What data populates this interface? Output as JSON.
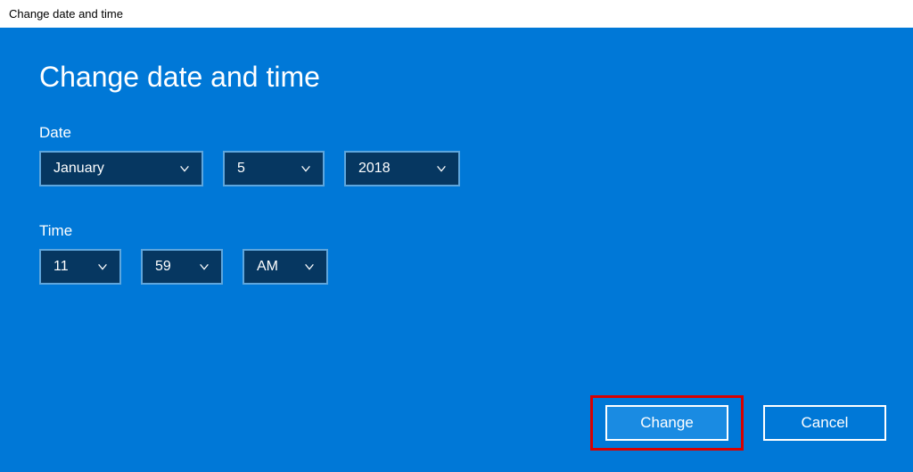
{
  "window": {
    "title": "Change date and time"
  },
  "heading": "Change date and time",
  "date": {
    "label": "Date",
    "month": "January",
    "day": "5",
    "year": "2018"
  },
  "time": {
    "label": "Time",
    "hour": "11",
    "minute": "59",
    "ampm": "AM"
  },
  "buttons": {
    "change": "Change",
    "cancel": "Cancel"
  }
}
